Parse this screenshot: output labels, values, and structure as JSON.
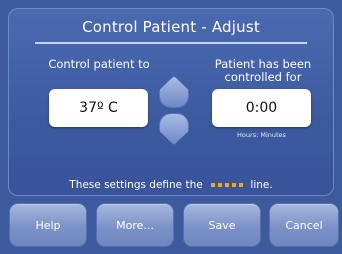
{
  "screen": {
    "title": "Control Patient - Adjust"
  },
  "target": {
    "label": "Control patient to",
    "value": "37º C"
  },
  "duration": {
    "label": "Patient has been controlled for",
    "value": "0:00",
    "units": "Hours: Minutes"
  },
  "note": {
    "prefix": "These settings define the",
    "suffix": "line.",
    "line_color": "#f2a61b"
  },
  "icons": {
    "up": "up-arrow-icon",
    "down": "down-arrow-icon"
  },
  "buttons": {
    "help": "Help",
    "more": "More...",
    "save": "Save",
    "cancel": "Cancel"
  }
}
